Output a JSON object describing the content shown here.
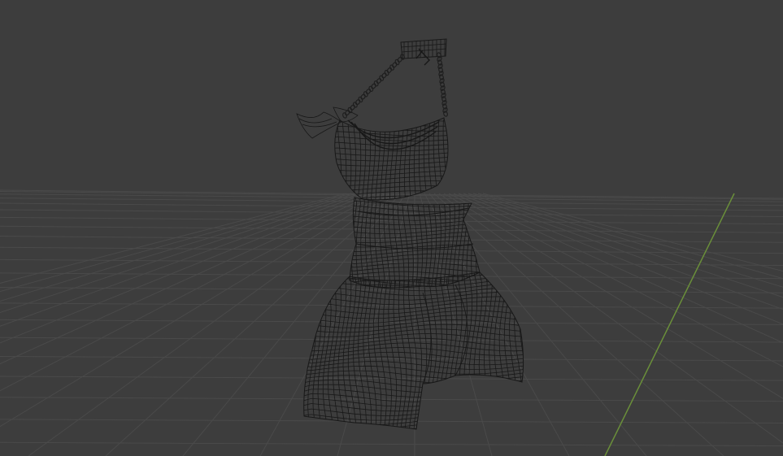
{
  "viewport": {
    "mode": "3d-viewport",
    "shading": "wireframe",
    "background_color": "#3d3d3d",
    "grid_line_color": "#4a4a4a",
    "grid_line_color_major": "#525252",
    "y_axis_color": "#6a8f3a",
    "wireframe_color": "#181818"
  },
  "scene": {
    "object": "dress-mesh",
    "object_parts": [
      "choker",
      "chain-strap",
      "bodice",
      "waist-band",
      "skirt"
    ]
  }
}
